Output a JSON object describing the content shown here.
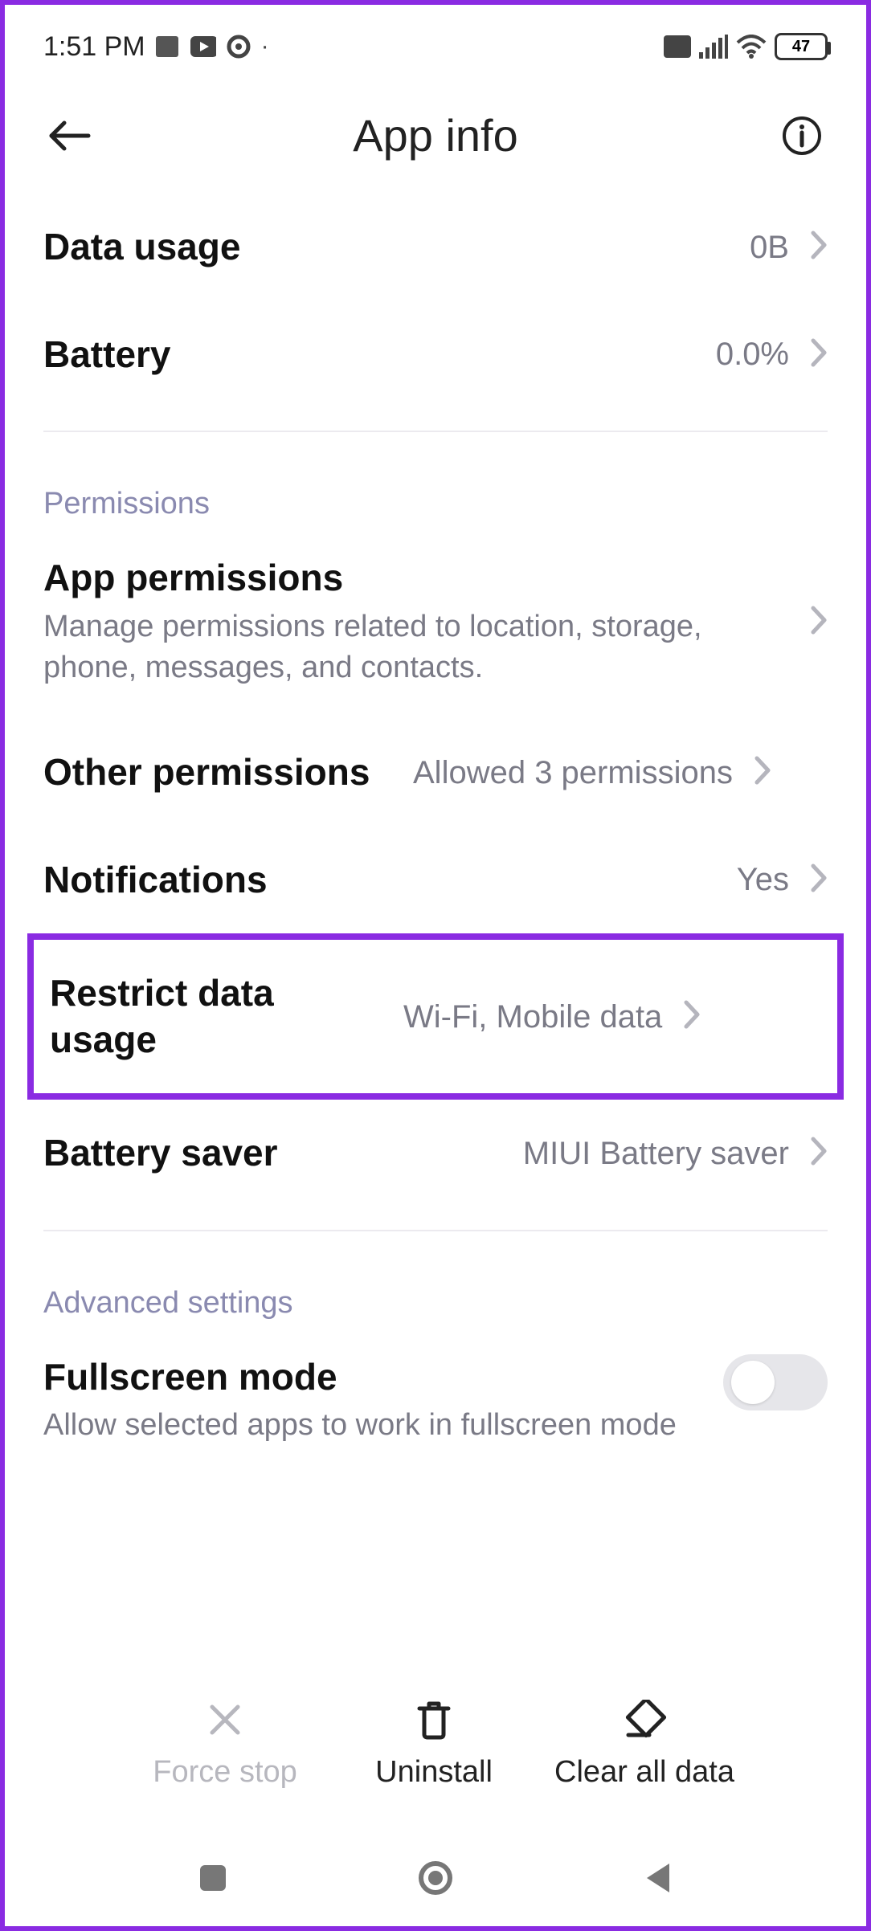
{
  "status": {
    "time": "1:51 PM",
    "battery": "47"
  },
  "header": {
    "title": "App info"
  },
  "rows": {
    "data_usage": {
      "title": "Data usage",
      "value": "0B"
    },
    "battery": {
      "title": "Battery",
      "value": "0.0%"
    }
  },
  "sections": {
    "permissions_label": "Permissions",
    "advanced_label": "Advanced settings"
  },
  "permissions": {
    "app_permissions": {
      "title": "App permissions",
      "sub": "Manage permissions related to location, storage, phone, messages, and contacts."
    },
    "other_permissions": {
      "title": "Other permissions",
      "value": "Allowed 3 permissions"
    },
    "notifications": {
      "title": "Notifications",
      "value": "Yes"
    },
    "restrict_data": {
      "title": "Restrict data usage",
      "value": "Wi-Fi, Mobile data"
    },
    "battery_saver": {
      "title": "Battery saver",
      "value": "MIUI Battery saver"
    }
  },
  "advanced": {
    "fullscreen": {
      "title": "Fullscreen mode",
      "sub": "Allow selected apps to work in fullscreen mode"
    }
  },
  "actions": {
    "force_stop": "Force stop",
    "uninstall": "Uninstall",
    "clear_all": "Clear all data"
  }
}
